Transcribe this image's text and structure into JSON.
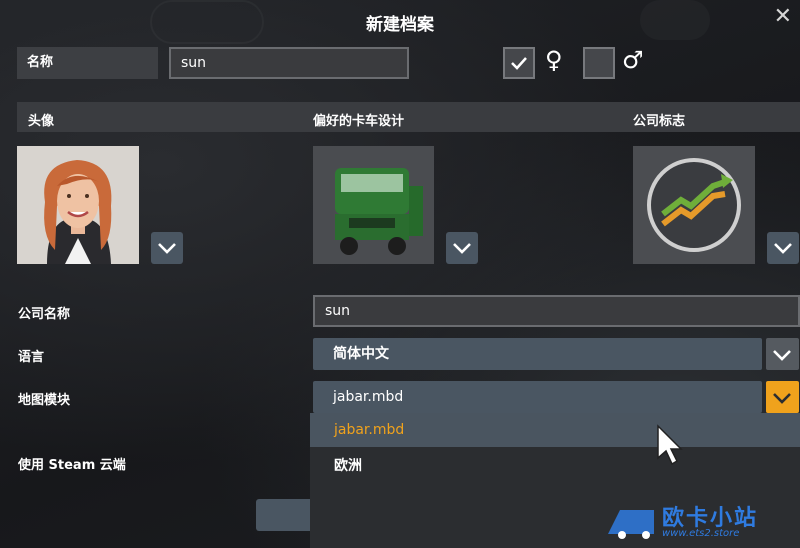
{
  "dialog": {
    "title": "新建档案",
    "close_symbol": "✕"
  },
  "name_row": {
    "label": "名称",
    "value": "sun",
    "female_checked": true,
    "female_symbol": "♀",
    "male_checked": false,
    "male_symbol": "♂"
  },
  "sections": {
    "avatar_label": "头像",
    "truck_label": "偏好的卡车设计",
    "logo_label": "公司标志"
  },
  "company": {
    "label": "公司名称",
    "value": "sun"
  },
  "language": {
    "label": "语言",
    "selected": "简体中文"
  },
  "map_module": {
    "label": "地图模块",
    "selected": "jabar.mbd",
    "options": [
      "jabar.mbd",
      "欧洲"
    ]
  },
  "steam": {
    "label": "使用 Steam 云端"
  },
  "watermark": {
    "text": "欧卡小站",
    "url": "www.ets2.store"
  },
  "colors": {
    "accent_orange": "#f0a21c",
    "select_bg": "#4a5662",
    "dropdown_bg": "#2b2d30"
  }
}
